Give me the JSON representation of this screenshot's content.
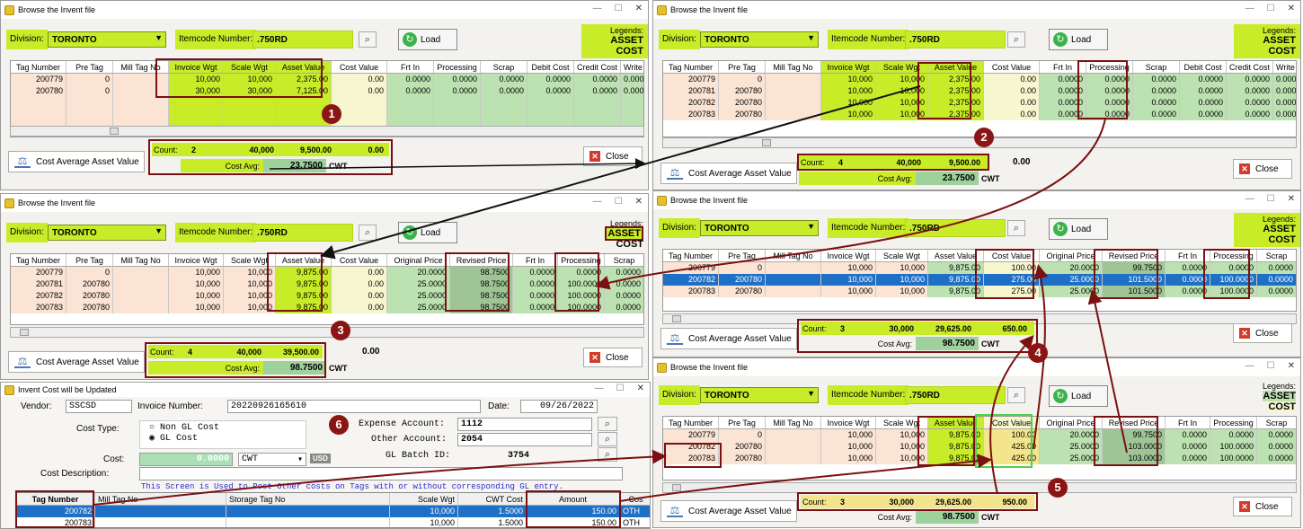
{
  "windows": [
    {
      "id": "w1",
      "title": "Browse the Invent file",
      "division_label": "Division:",
      "division": "TORONTO",
      "itemcode_label": "Itemcode Number:",
      "itemcode": ".750RD",
      "load": "Load",
      "legends_title": "Legends:",
      "legend_a": "ASSET",
      "legend_b": "COST",
      "columns": [
        "Tag Number",
        "Pre Tag",
        "Mill Tag No",
        "Invoice Wgt",
        "Scale Wgt",
        "Asset Value",
        "Cost Value",
        "Frt In",
        "Processing",
        "Scrap",
        "Debit Cost",
        "Credit Cost",
        "Write Dc"
      ],
      "rows": [
        [
          "200779",
          "0",
          "",
          "10,000",
          "10,000",
          "2,375.00",
          "0.00",
          "0.0000",
          "0.0000",
          "0.0000",
          "0.0000",
          "0.0000",
          "0.0000"
        ],
        [
          "200780",
          "0",
          "",
          "30,000",
          "30,000",
          "7,125.00",
          "0.00",
          "0.0000",
          "0.0000",
          "0.0000",
          "0.0000",
          "0.0000",
          "0.0000"
        ]
      ],
      "count_label": "Count:",
      "count": "2",
      "sum_wgt": "40,000",
      "sum_asset": "9,500.00",
      "sum_cost": "0.00",
      "avg_label": "Cost Avg:",
      "avg": "23.7500",
      "unit": "CWT",
      "cab": "Cost Average Asset Value",
      "close": "Close"
    },
    {
      "id": "w2",
      "title": "Browse the Invent file",
      "division_label": "Division:",
      "division": "TORONTO",
      "itemcode_label": "Itemcode Number:",
      "itemcode": ".750RD",
      "load": "Load",
      "legends_title": "Legends:",
      "legend_a": "ASSET",
      "legend_b": "COST",
      "columns": [
        "Tag Number",
        "Pre Tag",
        "Mill Tag No",
        "Invoice Wgt",
        "Scale Wgt",
        "Asset Value",
        "Cost Value",
        "Frt In",
        "Processing",
        "Scrap",
        "Debit Cost",
        "Credit Cost",
        "Write Dc"
      ],
      "rows": [
        [
          "200779",
          "0",
          "",
          "10,000",
          "10,000",
          "2,375.00",
          "0.00",
          "0.0000",
          "0.0000",
          "0.0000",
          "0.0000",
          "0.0000",
          "0.0000"
        ],
        [
          "200781",
          "200780",
          "",
          "10,000",
          "10,000",
          "2,375.00",
          "0.00",
          "0.0000",
          "0.0000",
          "0.0000",
          "0.0000",
          "0.0000",
          "0.0000"
        ],
        [
          "200782",
          "200780",
          "",
          "10,000",
          "10,000",
          "2,375.00",
          "0.00",
          "0.0000",
          "0.0000",
          "0.0000",
          "0.0000",
          "0.0000",
          "0.0000"
        ],
        [
          "200783",
          "200780",
          "",
          "10,000",
          "10,000",
          "2,375.00",
          "0.00",
          "0.0000",
          "0.0000",
          "0.0000",
          "0.0000",
          "0.0000",
          "0.0000"
        ]
      ],
      "count_label": "Count:",
      "count": "4",
      "sum_wgt": "40,000",
      "sum_asset": "9,500.00",
      "sum_cost": "0.00",
      "avg_label": "Cost Avg:",
      "avg": "23.7500",
      "unit": "CWT",
      "cab": "Cost Average Asset Value",
      "close": "Close"
    },
    {
      "id": "w3",
      "title": "Browse the Invent file",
      "division_label": "Division:",
      "division": "TORONTO",
      "itemcode_label": "Itemcode Number:",
      "itemcode": ".750RD",
      "load": "Load",
      "legends_title": "Legends:",
      "legend_a": "ASSET",
      "legend_b": "COST",
      "columns": [
        "Tag Number",
        "Pre Tag",
        "Mill Tag No",
        "Invoice Wgt",
        "Scale Wgt",
        "Asset Value",
        "Cost Value",
        "Original Price",
        "Revised Price",
        "Frt In",
        "Processing",
        "Scrap"
      ],
      "rows": [
        [
          "200779",
          "0",
          "",
          "10,000",
          "10,000",
          "9,875.00",
          "0.00",
          "20.0000",
          "98.7500",
          "0.0000",
          "0.0000",
          "0.0000"
        ],
        [
          "200781",
          "200780",
          "",
          "10,000",
          "10,000",
          "9,875.00",
          "0.00",
          "25.0000",
          "98.7500",
          "0.0000",
          "100.0000",
          "0.0000"
        ],
        [
          "200782",
          "200780",
          "",
          "10,000",
          "10,000",
          "9,875.00",
          "0.00",
          "25.0000",
          "98.7500",
          "0.0000",
          "100.0000",
          "0.0000"
        ],
        [
          "200783",
          "200780",
          "",
          "10,000",
          "10,000",
          "9,875.00",
          "0.00",
          "25.0000",
          "98.7500",
          "0.0000",
          "100.0000",
          "0.0000"
        ]
      ],
      "count_label": "Count:",
      "count": "4",
      "sum_wgt": "40,000",
      "sum_asset": "39,500.00",
      "sum_cost": "0.00",
      "avg_label": "Cost Avg:",
      "avg": "98.7500",
      "unit": "CWT",
      "cab": "Cost Average Asset Value",
      "close": "Close"
    },
    {
      "id": "w4",
      "title": "Browse the Invent file",
      "division_label": "Division:",
      "division": "TORONTO",
      "itemcode_label": "Itemcode Number:",
      "itemcode": ".750RD",
      "load": "Load",
      "legends_title": "Legends:",
      "legend_a": "ASSET",
      "legend_b": "COST",
      "columns": [
        "Tag Number",
        "Pre Tag",
        "Mill Tag No",
        "Invoice Wgt",
        "Scale Wgt",
        "Asset Value",
        "Cost Value",
        "Original Price",
        "Revised Price",
        "Frt In",
        "Processing",
        "Scrap"
      ],
      "rows": [
        [
          "200779",
          "0",
          "",
          "10,000",
          "10,000",
          "9,875.00",
          "100.00",
          "20.0000",
          "99.7500",
          "0.0000",
          "0.0000",
          "0.0000"
        ],
        [
          "200782",
          "200780",
          "",
          "10,000",
          "10,000",
          "9,875.00",
          "275.00",
          "25.0000",
          "101.5000",
          "0.0000",
          "100.0000",
          "0.0000"
        ],
        [
          "200783",
          "200780",
          "",
          "10,000",
          "10,000",
          "9,875.00",
          "275.00",
          "25.0000",
          "101.5000",
          "0.0000",
          "100.0000",
          "0.0000"
        ]
      ],
      "count_label": "Count:",
      "count": "3",
      "sum_wgt": "30,000",
      "sum_asset": "29,625.00",
      "sum_cost": "650.00",
      "avg_label": "Cost Avg:",
      "avg": "98.7500",
      "unit": "CWT",
      "cab": "Cost Average Asset Value",
      "close": "Close"
    },
    {
      "id": "w5",
      "title": "Browse the Invent file",
      "division_label": "Division:",
      "division": "TORONTO",
      "itemcode_label": "Itemcode Number:",
      "itemcode": ".750RD",
      "load": "Load",
      "legends_title": "Legends:",
      "legend_a": "ASSET",
      "legend_b": "COST",
      "columns": [
        "Tag Number",
        "Pre Tag",
        "Mill Tag No",
        "Invoice Wgt",
        "Scale Wgt",
        "Asset Value",
        "Cost Value",
        "Original Price",
        "Revised Price",
        "Frt In",
        "Processing",
        "Scrap"
      ],
      "rows": [
        [
          "200779",
          "0",
          "",
          "10,000",
          "10,000",
          "9,875.00",
          "100.00",
          "20.0000",
          "99.7500",
          "0.0000",
          "0.0000",
          "0.0000"
        ],
        [
          "200782",
          "200780",
          "",
          "10,000",
          "10,000",
          "9,875.00",
          "425.00",
          "25.0000",
          "103.0000",
          "0.0000",
          "100.0000",
          "0.0000"
        ],
        [
          "200783",
          "200780",
          "",
          "10,000",
          "10,000",
          "9,875.00",
          "425.00",
          "25.0000",
          "103.0000",
          "0.0000",
          "100.0000",
          "0.0000"
        ]
      ],
      "count_label": "Count:",
      "count": "3",
      "sum_wgt": "30,000",
      "sum_asset": "29,625.00",
      "sum_cost": "950.00",
      "avg_label": "Cost Avg:",
      "avg": "98.7500",
      "unit": "CWT",
      "cab": "Cost Average Asset Value",
      "close": "Close"
    }
  ],
  "costwin": {
    "title": "Invent Cost  will be Updated",
    "vendor_label": "Vendor:",
    "vendor": "SSCSD",
    "invoice_label": "Invoice Number:",
    "invoice": "20220926165610",
    "date_label": "Date:",
    "date": "09/26/2022",
    "costtype_label": "Cost Type:",
    "opt_non": "Non GL Cost",
    "opt_gl": "GL Cost",
    "cost_label": "Cost:",
    "cost": "0.0000",
    "cost_unit": "CWT",
    "currency": "USD",
    "desc_label": "Cost Description:",
    "expense_label": "Expense Account:",
    "expense": "1112",
    "other_label": "Other Account:",
    "other": "2054",
    "batch_label": "GL Batch ID:",
    "batch": "3754",
    "note": "This Screen is Used to Post Other costs on Tags with or without corresponding GL entry.",
    "columns": [
      "Tag Number",
      "Mill Tag No",
      "Storage Tag No",
      "Scale Wgt",
      "CWT Cost",
      "Amount",
      "Cos"
    ],
    "rows": [
      [
        "200782",
        "",
        "",
        "10,000",
        "1.5000",
        "150.00",
        "OTH"
      ],
      [
        "200783",
        "",
        "",
        "10,000",
        "1.5000",
        "150.00",
        "OTH"
      ]
    ]
  },
  "badges": [
    "1",
    "2",
    "3",
    "4",
    "5",
    "6"
  ],
  "colors": {
    "accent": "#c8ec28",
    "highlight": "#7a1010",
    "asset": "#bde2b1",
    "cost": "#f7f7cf"
  }
}
